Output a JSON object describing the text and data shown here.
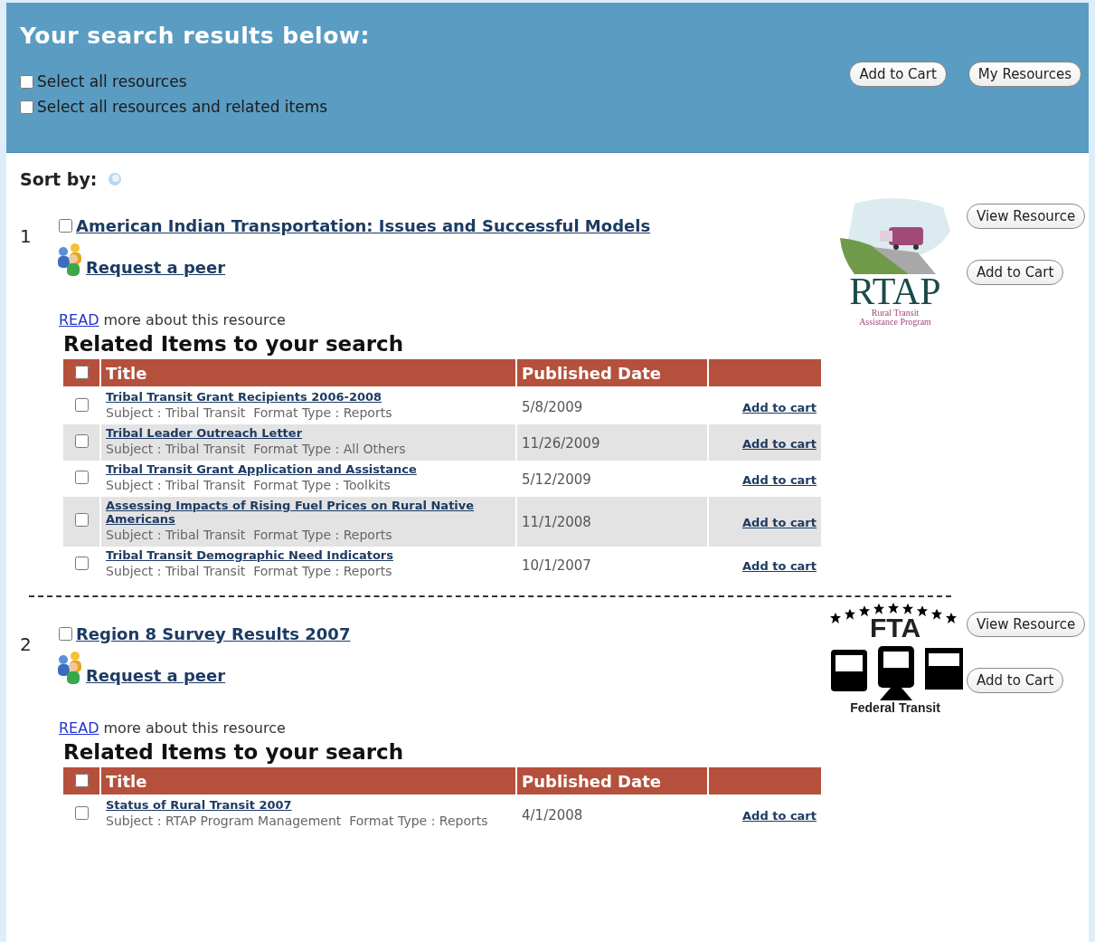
{
  "header": {
    "title": "Your search results below:",
    "select_options": [
      {
        "label": "Select all resources",
        "checked": false
      },
      {
        "label": "Select all resources and related items",
        "checked": false
      }
    ],
    "buttons": [
      "Add to Cart",
      "My Resources"
    ]
  },
  "sort": {
    "label": "Sort by:"
  },
  "results": [
    {
      "number": "1",
      "title": "American Indian Transportation: Issues and Successful Models",
      "checked": false,
      "peer_link": "Request a peer",
      "read_link": "READ",
      "read_text": "more about this resource",
      "logo": {
        "kind": "rtap",
        "texts": [
          "RTAP",
          "Rural Transit",
          "Assistance Program"
        ]
      },
      "buttons": [
        "View Resource",
        "Add to Cart"
      ],
      "related": {
        "heading": "Related Items to your search",
        "header_checked": false,
        "columns": [
          "Title",
          "Published Date"
        ],
        "rows": [
          {
            "title": "Tribal Transit Grant Recipients 2006-2008",
            "subject": "Subject : Tribal Transit  Format Type : Reports",
            "date": "5/8/2009",
            "action": "Add to cart",
            "checked": false
          },
          {
            "title": "Tribal Leader Outreach Letter",
            "subject": "Subject : Tribal Transit  Format Type : All Others",
            "date": "11/26/2009",
            "action": "Add to cart",
            "checked": false
          },
          {
            "title": "Tribal Transit Grant Application and Assistance",
            "subject": "Subject : Tribal Transit  Format Type : Toolkits",
            "date": "5/12/2009",
            "action": "Add to cart",
            "checked": false
          },
          {
            "title": "Assessing Impacts of Rising Fuel Prices on Rural Native Americans",
            "subject": "Subject : Tribal Transit  Format Type : Reports",
            "date": "11/1/2008",
            "action": "Add to cart",
            "checked": false
          },
          {
            "title": "Tribal Transit Demographic Need Indicators",
            "subject": "Subject : Tribal Transit  Format Type : Reports",
            "date": "10/1/2007",
            "action": "Add to cart",
            "checked": false
          }
        ]
      }
    },
    {
      "number": "2",
      "title": "Region 8 Survey Results 2007",
      "checked": false,
      "peer_link": "Request a peer",
      "read_link": "READ",
      "read_text": "more about this resource",
      "logo": {
        "kind": "fta",
        "texts": [
          "FTA",
          "Federal Transit"
        ]
      },
      "buttons": [
        "View Resource",
        "Add to Cart"
      ],
      "related": {
        "heading": "Related Items to your search",
        "header_checked": false,
        "columns": [
          "Title",
          "Published Date"
        ],
        "rows": [
          {
            "title": "Status of Rural Transit 2007",
            "subject": "Subject : RTAP Program Management  Format Type : Reports",
            "date": "4/1/2008",
            "action": "Add to cart",
            "checked": false
          }
        ]
      }
    }
  ]
}
